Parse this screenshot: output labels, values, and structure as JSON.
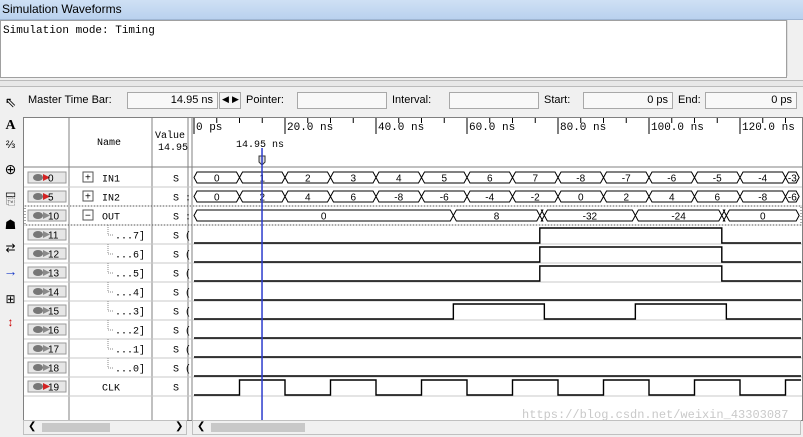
{
  "window": {
    "title": "Simulation Waveforms"
  },
  "mode": {
    "text": "Simulation mode: Timing"
  },
  "timebar": {
    "master_label": "Master Time Bar:",
    "master_value": "14.95 ns",
    "pointer_label": "Pointer:",
    "pointer_value": "",
    "interval_label": "Interval:",
    "interval_value": "",
    "start_label": "Start:",
    "start_value": "0 ps",
    "end_label": "End:",
    "end_value": "0 ps"
  },
  "header": {
    "name_label": "Name",
    "value_label_line1": "Value",
    "value_label_line2": "14.95",
    "cursor_label": "14.95 ns",
    "ticks": [
      "0 ps",
      "20.0 ns",
      "40.0 ns",
      "60.0 ns",
      "80.0 ns",
      "100.0 ns",
      "120.0 ns"
    ]
  },
  "signals": [
    {
      "index": "0",
      "name": "IN1",
      "value": "S",
      "expand": "+",
      "type": "bus-in"
    },
    {
      "index": "5",
      "name": "IN2",
      "value": "S :",
      "expand": "+",
      "type": "bus-in"
    },
    {
      "index": "10",
      "name": "OUT",
      "value": "S :",
      "expand": "−",
      "type": "bus-out"
    },
    {
      "index": "11",
      "name": "...7]",
      "value": "S (",
      "type": "bit-out"
    },
    {
      "index": "12",
      "name": "...6]",
      "value": "S (",
      "type": "bit-out"
    },
    {
      "index": "13",
      "name": "...5]",
      "value": "S (",
      "type": "bit-out"
    },
    {
      "index": "14",
      "name": "...4]",
      "value": "S (",
      "type": "bit-out"
    },
    {
      "index": "15",
      "name": "...3]",
      "value": "S (",
      "type": "bit-out"
    },
    {
      "index": "16",
      "name": "...2]",
      "value": "S (",
      "type": "bit-out"
    },
    {
      "index": "17",
      "name": "...1]",
      "value": "S (",
      "type": "bit-out"
    },
    {
      "index": "18",
      "name": "...0]",
      "value": "S (",
      "type": "bit-out"
    },
    {
      "index": "19",
      "name": "CLK",
      "value": "S",
      "type": "bit-in"
    }
  ],
  "waves": {
    "time_end_ns": 133,
    "cursor_ns": 14.95,
    "buses": [
      {
        "row": 0,
        "segments": [
          {
            "t0": 0,
            "t1": 10,
            "v": "0"
          },
          {
            "t0": 10,
            "t1": 20,
            "v": "1"
          },
          {
            "t0": 20,
            "t1": 30,
            "v": "2"
          },
          {
            "t0": 30,
            "t1": 40,
            "v": "3"
          },
          {
            "t0": 40,
            "t1": 50,
            "v": "4"
          },
          {
            "t0": 50,
            "t1": 60,
            "v": "5"
          },
          {
            "t0": 60,
            "t1": 70,
            "v": "6"
          },
          {
            "t0": 70,
            "t1": 80,
            "v": "7"
          },
          {
            "t0": 80,
            "t1": 90,
            "v": "-8"
          },
          {
            "t0": 90,
            "t1": 100,
            "v": "-7"
          },
          {
            "t0": 100,
            "t1": 110,
            "v": "-6"
          },
          {
            "t0": 110,
            "t1": 120,
            "v": "-5"
          },
          {
            "t0": 120,
            "t1": 130,
            "v": "-4"
          },
          {
            "t0": 130,
            "t1": 133,
            "v": "-3"
          }
        ]
      },
      {
        "row": 1,
        "segments": [
          {
            "t0": 0,
            "t1": 10,
            "v": "0"
          },
          {
            "t0": 10,
            "t1": 20,
            "v": "2"
          },
          {
            "t0": 20,
            "t1": 30,
            "v": "4"
          },
          {
            "t0": 30,
            "t1": 40,
            "v": "6"
          },
          {
            "t0": 40,
            "t1": 50,
            "v": "-8"
          },
          {
            "t0": 50,
            "t1": 60,
            "v": "-6"
          },
          {
            "t0": 60,
            "t1": 70,
            "v": "-4"
          },
          {
            "t0": 70,
            "t1": 80,
            "v": "-2"
          },
          {
            "t0": 80,
            "t1": 90,
            "v": "0"
          },
          {
            "t0": 90,
            "t1": 100,
            "v": "2"
          },
          {
            "t0": 100,
            "t1": 110,
            "v": "4"
          },
          {
            "t0": 110,
            "t1": 120,
            "v": "6"
          },
          {
            "t0": 120,
            "t1": 130,
            "v": "-8"
          },
          {
            "t0": 130,
            "t1": 133,
            "v": "-6"
          }
        ]
      },
      {
        "row": 2,
        "segments": [
          {
            "t0": 0,
            "t1": 57,
            "v": "0"
          },
          {
            "t0": 57,
            "t1": 76,
            "v": "8"
          },
          {
            "t0": 76,
            "t1": 77,
            "v": ""
          },
          {
            "t0": 77,
            "t1": 97,
            "v": "-32"
          },
          {
            "t0": 97,
            "t1": 116,
            "v": "-24"
          },
          {
            "t0": 116,
            "t1": 117,
            "v": ""
          },
          {
            "t0": 117,
            "t1": 133,
            "v": "0"
          }
        ]
      }
    ],
    "bits": [
      {
        "row": 3,
        "edges": [
          [
            0,
            0
          ],
          [
            76,
            1
          ],
          [
            116,
            0
          ]
        ]
      },
      {
        "row": 4,
        "edges": [
          [
            0,
            0
          ],
          [
            76,
            1
          ],
          [
            116,
            0
          ]
        ]
      },
      {
        "row": 5,
        "edges": [
          [
            0,
            0
          ],
          [
            76,
            1
          ],
          [
            116,
            0
          ]
        ]
      },
      {
        "row": 6,
        "edges": [
          [
            0,
            0
          ]
        ]
      },
      {
        "row": 7,
        "edges": [
          [
            0,
            0
          ],
          [
            57,
            1
          ],
          [
            77,
            0
          ],
          [
            97,
            1
          ],
          [
            117,
            0
          ]
        ]
      },
      {
        "row": 8,
        "edges": [
          [
            0,
            0
          ]
        ]
      },
      {
        "row": 9,
        "edges": [
          [
            0,
            0
          ]
        ]
      },
      {
        "row": 10,
        "edges": [
          [
            0,
            0
          ]
        ]
      },
      {
        "row": 11,
        "edges": [
          [
            0,
            0
          ],
          [
            10,
            1
          ],
          [
            20,
            0
          ],
          [
            30,
            1
          ],
          [
            40,
            0
          ],
          [
            50,
            1
          ],
          [
            60,
            0
          ],
          [
            70,
            1
          ],
          [
            80,
            0
          ],
          [
            90,
            1
          ],
          [
            100,
            0
          ],
          [
            110,
            1
          ],
          [
            120,
            0
          ],
          [
            130,
            1
          ]
        ]
      }
    ]
  },
  "watermark": "https://blog.csdn.net/weixin_43303087",
  "colors": {
    "wave": "#000000",
    "cursor": "#2c3ccc",
    "grid": "#a0a0a0",
    "title_bg": "#c4d8f0"
  }
}
